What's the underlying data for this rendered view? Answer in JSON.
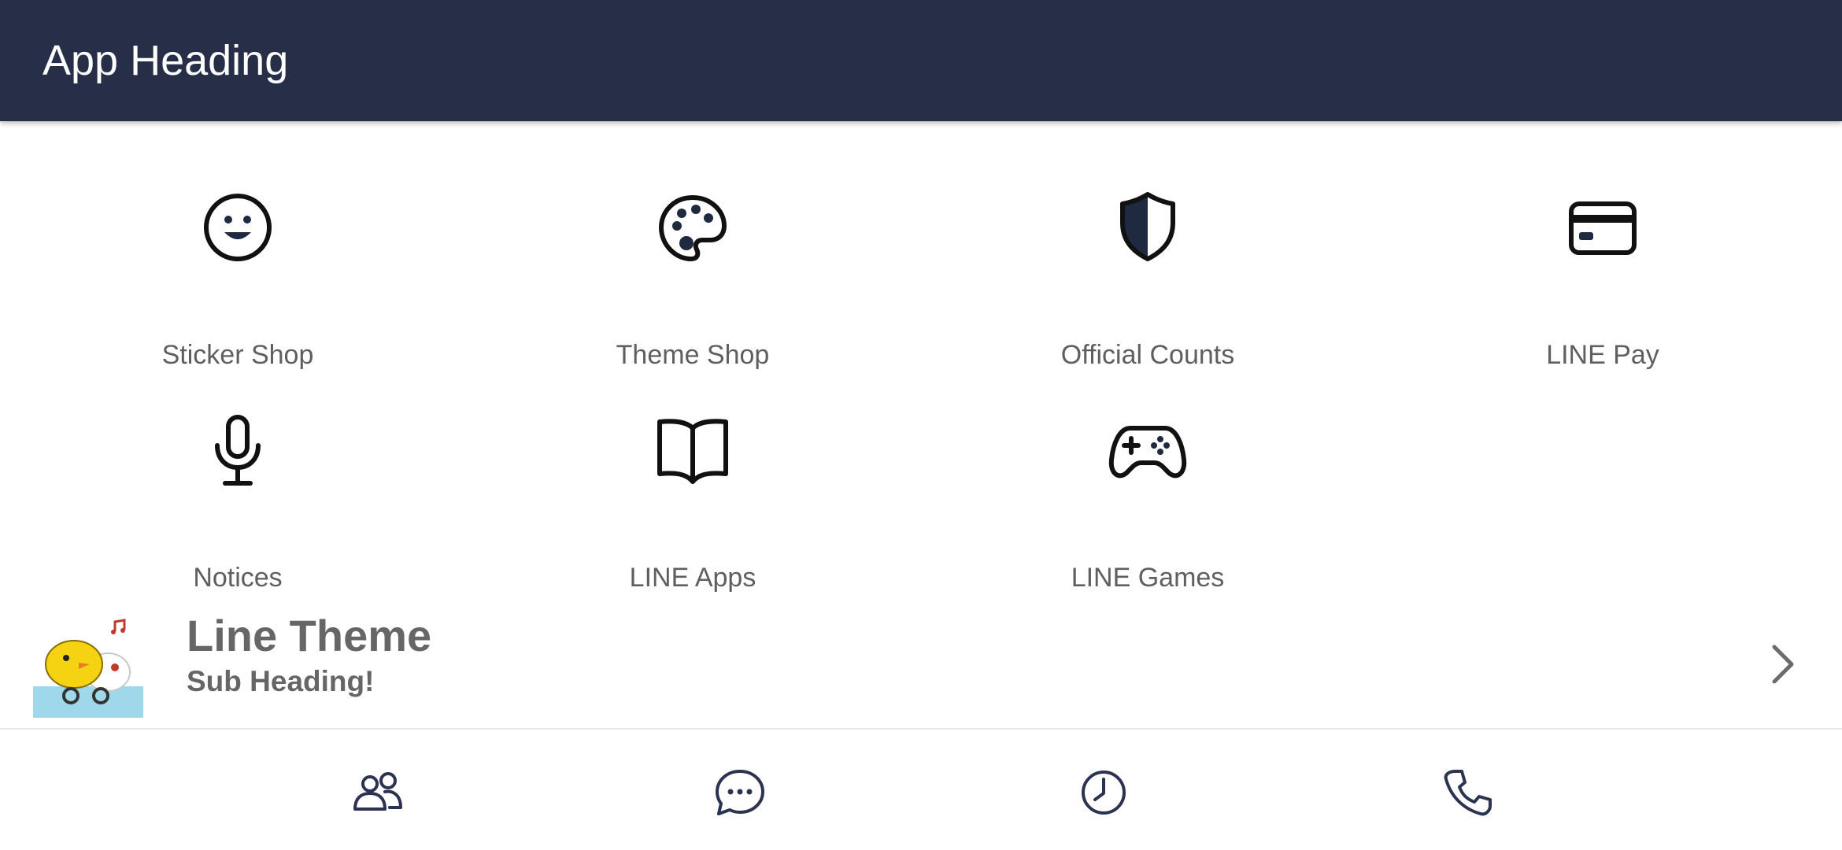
{
  "header": {
    "title": "App Heading"
  },
  "grid": {
    "items": [
      {
        "label": "Sticker Shop",
        "icon": "smiley-icon"
      },
      {
        "label": "Theme Shop",
        "icon": "palette-icon"
      },
      {
        "label": "Official Counts",
        "icon": "shield-icon"
      },
      {
        "label": "LINE Pay",
        "icon": "credit-card-icon"
      },
      {
        "label": "Notices",
        "icon": "microphone-icon"
      },
      {
        "label": "LINE Apps",
        "icon": "book-icon"
      },
      {
        "label": "LINE Games",
        "icon": "gamepad-icon"
      }
    ]
  },
  "promo": {
    "title": "Line Theme",
    "subtitle": "Sub Heading!",
    "thumbnail": "chick-sticker-image",
    "chevron": "chevron-right-icon"
  },
  "bottom_nav": {
    "items": [
      {
        "icon": "friends-icon"
      },
      {
        "icon": "chat-icon"
      },
      {
        "icon": "clock-icon"
      },
      {
        "icon": "phone-icon"
      }
    ]
  },
  "colors": {
    "header_bg": "#272f48",
    "icon": "#1f2940",
    "label": "#5f5f5f",
    "promo_text": "#666666"
  }
}
